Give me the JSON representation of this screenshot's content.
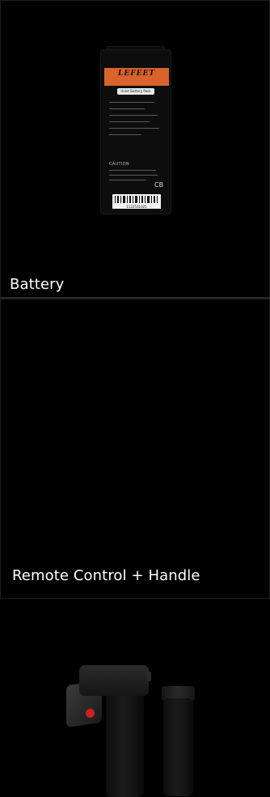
{
  "products": [
    {
      "label": "Battery",
      "image_icon": "battery-pack-image",
      "battery_print": {
        "brand": "LEFEET",
        "pill": "Unlet Battery Pack",
        "caution": "CAUTION",
        "barcode_number": "1122531025",
        "mark": "CB"
      }
    },
    {
      "label": "Remote Control + Handle",
      "image_icon": "remote-control-handle-image",
      "accent_color": "#d21f27"
    }
  ]
}
